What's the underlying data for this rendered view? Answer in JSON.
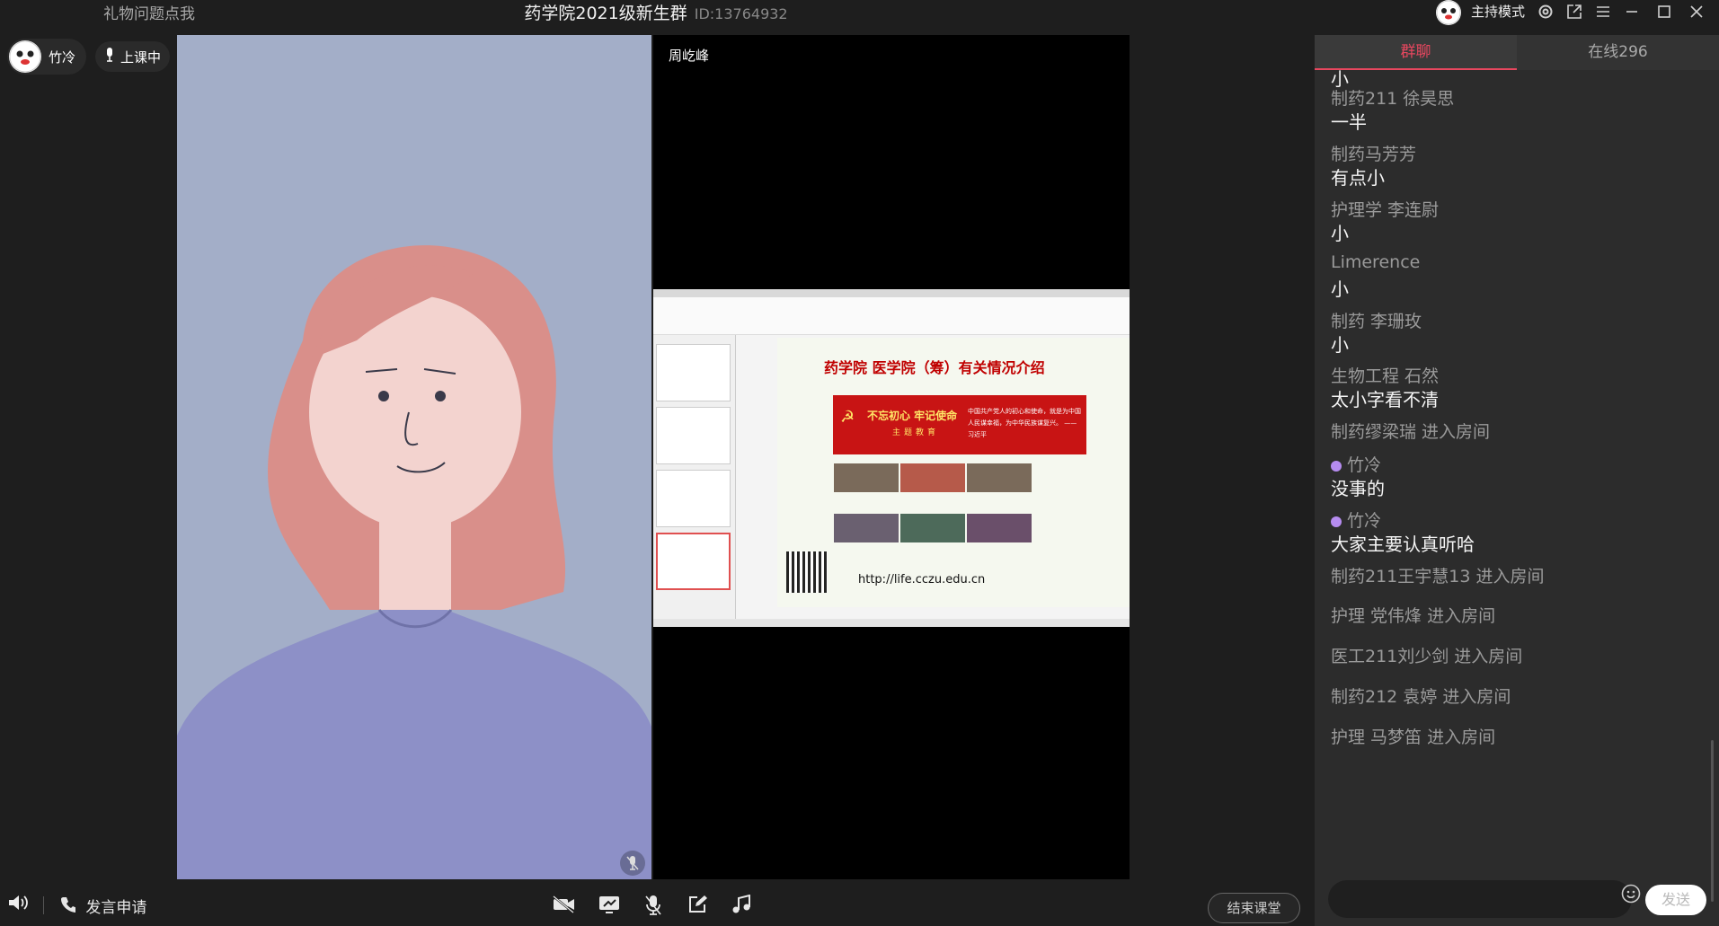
{
  "titlebar": {
    "gift_link": "礼物问题点我",
    "room_name": "药学院2021级新生群",
    "room_id": "ID:13764932",
    "host_mode_label": "主持模式",
    "icons": [
      "settings-icon",
      "popout-icon",
      "menu-icon",
      "minimize-icon",
      "maximize-icon",
      "close-icon"
    ]
  },
  "stage": {
    "user_name": "竹冷",
    "class_status": "上课中",
    "presenter_name": "周屹峰",
    "shared_screen": {
      "slide_title": "药学院   医学院（筹）有关情况介绍",
      "banner_main": "不忘初心 牢记使命",
      "banner_sub": "主题教育",
      "banner_quote": "中国共产党人的初心和使命，就是为中国人民谋幸福，为中华民族谋复兴。 ——习近平",
      "url": "http://life.cczu.edu.cn"
    }
  },
  "bottom": {
    "apply_label": "发言申请",
    "end_button": "结束课堂",
    "controls": [
      "camera-icon",
      "screen-share-icon",
      "microphone-icon",
      "whiteboard-icon",
      "music-icon"
    ]
  },
  "chat": {
    "tabs": {
      "group": "群聊",
      "online": "在线296"
    },
    "messages": [
      {
        "text": "小"
      },
      {
        "sender": "制药211  徐昊思",
        "text": "一半"
      },
      {
        "sender": "制药马芳芳",
        "text": "有点小"
      },
      {
        "sender": "护理学  李连尉",
        "text": "小"
      },
      {
        "sender": "Limerence",
        "text": "小"
      },
      {
        "sender": "制药  李珊玫",
        "text": "小"
      },
      {
        "sender": "生物工程 石然",
        "text": "太小字看不清"
      },
      {
        "system": "制药缪梁瑞 进入房间"
      },
      {
        "sender": "竹冷",
        "text": "没事的"
      },
      {
        "sender": "竹冷",
        "text": "大家主要认真听哈"
      },
      {
        "system": "制药211王宇慧13 进入房间"
      },
      {
        "system": "护理   党伟烽 进入房间"
      },
      {
        "system": "医工211刘少剑 进入房间"
      },
      {
        "system": "制药212 袁婷 进入房间"
      },
      {
        "system": "护理 马梦笛 进入房间"
      }
    ],
    "input_placeholder": "",
    "send_label": "发送"
  }
}
